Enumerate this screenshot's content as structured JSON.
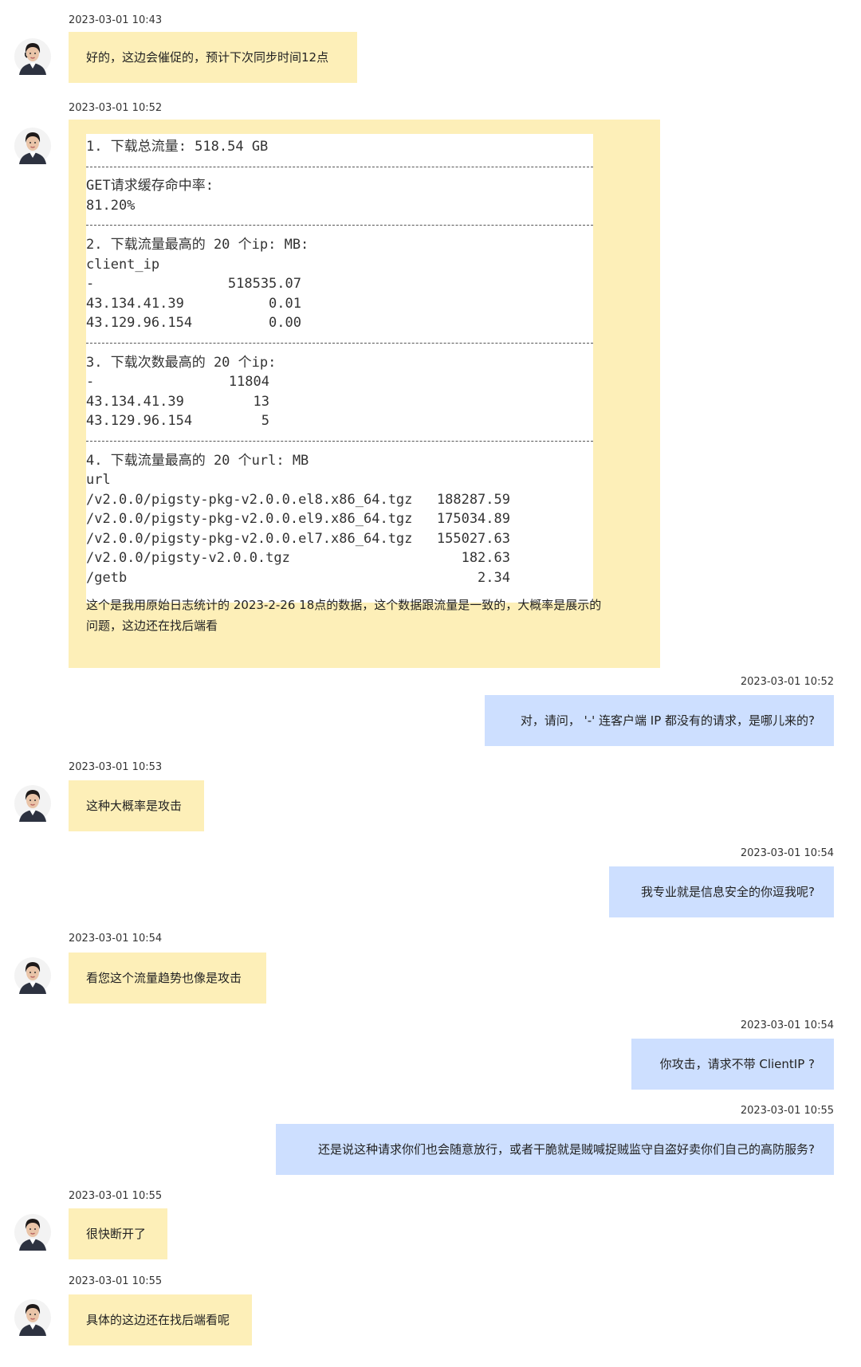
{
  "colors": {
    "agent_bubble": "#fdefb8",
    "user_bubble": "#cddfff"
  },
  "messages": [
    {
      "sender": "agent",
      "timestamp": "2023-03-01 10:43",
      "text": "好的，这边会催促的，预计下次同步时间12点"
    },
    {
      "sender": "agent",
      "timestamp": "2023-03-01 10:52",
      "report": {
        "section1_title": "1. 下载总流量: 518.54 GB",
        "get_hit_label": "GET请求缓存命中率:",
        "get_hit_value": "81.20%",
        "section2_title": "2. 下载流量最高的 20 个ip: MB:",
        "section2_header": "client_ip",
        "section2_rows": [
          {
            "key": "-",
            "value": "518535.07"
          },
          {
            "key": "43.134.41.39",
            "value": "0.01"
          },
          {
            "key": "43.129.96.154",
            "value": "0.00"
          }
        ],
        "section3_title": "3. 下载次数最高的 20 个ip:",
        "section3_rows": [
          {
            "key": "-",
            "value": "11804"
          },
          {
            "key": "43.134.41.39",
            "value": "13"
          },
          {
            "key": "43.129.96.154",
            "value": "5"
          }
        ],
        "section4_title": "4. 下载流量最高的 20 个url: MB",
        "section4_header": "url",
        "section4_rows": [
          {
            "key": "/v2.0.0/pigsty-pkg-v2.0.0.el8.x86_64.tgz",
            "value": "188287.59"
          },
          {
            "key": "/v2.0.0/pigsty-pkg-v2.0.0.el9.x86_64.tgz",
            "value": "175034.89"
          },
          {
            "key": "/v2.0.0/pigsty-pkg-v2.0.0.el7.x86_64.tgz",
            "value": "155027.63"
          },
          {
            "key": "/v2.0.0/pigsty-v2.0.0.tgz",
            "value": "182.63"
          },
          {
            "key": "/getb",
            "value": "2.34"
          }
        ]
      },
      "text_line1": "这个是我用原始日志统计的 2023-2-26 18点的数据，这个数据跟流量是一致的，大概率是展示的",
      "text_line2": "问题，这边还在找后端看"
    },
    {
      "sender": "user",
      "timestamp": "2023-03-01 10:52",
      "text": "对，请问， '-' 连客户端 IP 都没有的请求，是哪儿来的?"
    },
    {
      "sender": "agent",
      "timestamp": "2023-03-01 10:53",
      "text": "这种大概率是攻击"
    },
    {
      "sender": "user",
      "timestamp": "2023-03-01 10:54",
      "text": "我专业就是信息安全的你逗我呢?"
    },
    {
      "sender": "agent",
      "timestamp": "2023-03-01 10:54",
      "text": "看您这个流量趋势也像是攻击"
    },
    {
      "sender": "user",
      "timestamp": "2023-03-01 10:54",
      "text": "你攻击，请求不带 ClientIP ?"
    },
    {
      "sender": "user",
      "timestamp": "2023-03-01 10:55",
      "text": "还是说这种请求你们也会随意放行，或者干脆就是贼喊捉贼监守自盗好卖你们自己的高防服务?"
    },
    {
      "sender": "agent",
      "timestamp": "2023-03-01 10:55",
      "text": "很快断开了"
    },
    {
      "sender": "agent",
      "timestamp": "2023-03-01 10:55",
      "text": "具体的这边还在找后端看呢"
    }
  ]
}
